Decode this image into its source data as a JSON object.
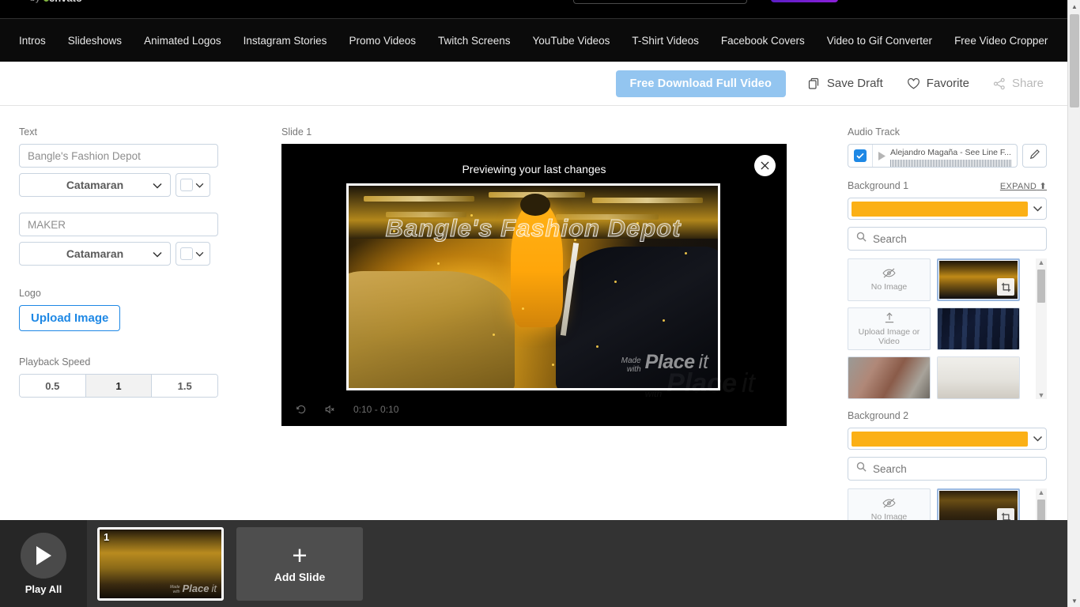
{
  "site": {
    "brand_by": "by",
    "brand_name": "envato",
    "nav_items": [
      "Intros",
      "Slideshows",
      "Animated Logos",
      "Instagram Stories",
      "Promo Videos",
      "Twitch Screens",
      "YouTube Videos",
      "T-Shirt Videos",
      "Facebook Covers",
      "Video to Gif Converter",
      "Free Video Cropper"
    ]
  },
  "actionbar": {
    "download_label": "Free Download Full Video",
    "save_draft_label": "Save Draft",
    "favorite_label": "Favorite",
    "share_label": "Share"
  },
  "left_panel": {
    "text_label": "Text",
    "text_line1_value": "Bangle's Fashion Depot",
    "text_line1_font": "Catamaran",
    "text_line2_value": "MAKER",
    "text_line2_font": "Catamaran",
    "color1": "#ffffff",
    "color2": "#ffffff",
    "logo_label": "Logo",
    "upload_image_label": "Upload Image",
    "playback_speed_label": "Playback Speed",
    "speeds": [
      "0.5",
      "1",
      "1.5"
    ],
    "active_speed": "1"
  },
  "center": {
    "slide_label": "Slide 1",
    "preview_caption": "Previewing your last changes",
    "close_icon": "close-icon",
    "video_title": "Bangle's Fashion Depot",
    "watermark_made": "Made",
    "watermark_with": "with",
    "watermark_place": "Place",
    "watermark_it": "it",
    "time_display": "0:10 - 0:10"
  },
  "right_panel": {
    "audio_track_label": "Audio Track",
    "audio_track_name": "Alejandro Magaña - See Line F...",
    "audio_enabled": true,
    "background1_label": "Background 1",
    "expand_label": "EXPAND",
    "background1_color": "#fbb016",
    "search_placeholder": "Search",
    "no_image_label": "No Image",
    "upload_image_or_video_label": "Upload Image or Video",
    "background2_label": "Background 2",
    "background2_color": "#fbb016",
    "thumbs_bg1": [
      {
        "name": "no-image",
        "kind": "no-image"
      },
      {
        "name": "garage-scene",
        "kind": "img-garage",
        "selected": true
      },
      {
        "name": "upload",
        "kind": "upload"
      },
      {
        "name": "code-screen",
        "kind": "img-code"
      },
      {
        "name": "brick-wall",
        "kind": "img-brick"
      },
      {
        "name": "living-room",
        "kind": "img-room"
      }
    ],
    "thumbs_bg2": [
      {
        "name": "no-image",
        "kind": "no-image"
      },
      {
        "name": "garage-scene",
        "kind": "img-garage2",
        "selected": true
      },
      {
        "name": "upload",
        "kind": "upload"
      },
      {
        "name": "code-screen",
        "kind": "img-code"
      }
    ]
  },
  "bottom": {
    "play_all_label": "Play All",
    "slide_number": "1",
    "add_slide_label": "Add Slide",
    "watermark_made": "Made",
    "watermark_with": "with",
    "watermark_place": "Place",
    "watermark_it": "it"
  },
  "colors": {
    "accent_blue": "#1e88e5",
    "download_button": "#93c5f0",
    "background_orange": "#fbb016",
    "nav_black": "#0b0b0b",
    "bottom_bar": "#262626"
  }
}
